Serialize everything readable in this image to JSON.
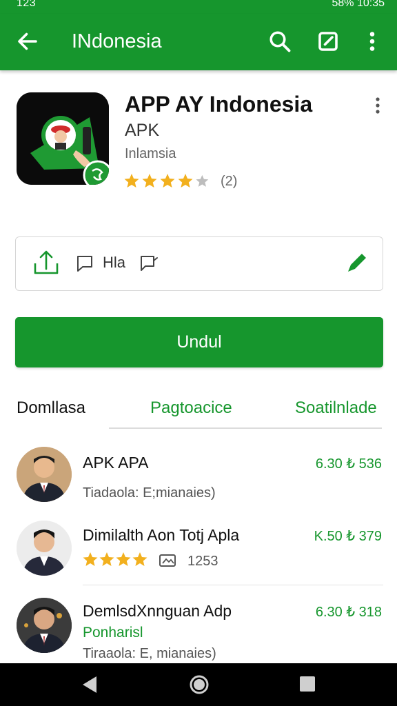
{
  "status_bar": {
    "left": "123",
    "right": "58%  10:35"
  },
  "app_bar": {
    "title": "INdonesia"
  },
  "app": {
    "name": "APP AY Indonesia",
    "type": "APK",
    "developer": "Inlamsia",
    "rating": 4.5,
    "rating_count": "(2)"
  },
  "actions": {
    "chip_label": "Hla"
  },
  "download_label": "Undul",
  "tabs": [
    {
      "label": "Domllasa"
    },
    {
      "label": "Pagtoacice"
    },
    {
      "label": "Soatilnlade"
    }
  ],
  "list": [
    {
      "title": "APK APA",
      "price": "6.30 ₺ 536",
      "subtitle": "Tiadaola: E;mianaies)"
    },
    {
      "title": "Dimilalth Aon Totj Apla",
      "price": "K.50 ₺ 379",
      "rating": 4,
      "count": "1253"
    },
    {
      "title": "DemlsdXnnguan Adp",
      "price": "6.30 ₺ 318",
      "tag": "Ponharisl",
      "subtitle": "Tiraaola: E, mianaies)"
    }
  ],
  "colors": {
    "primary": "#16962d",
    "star": "#f2b01e"
  }
}
